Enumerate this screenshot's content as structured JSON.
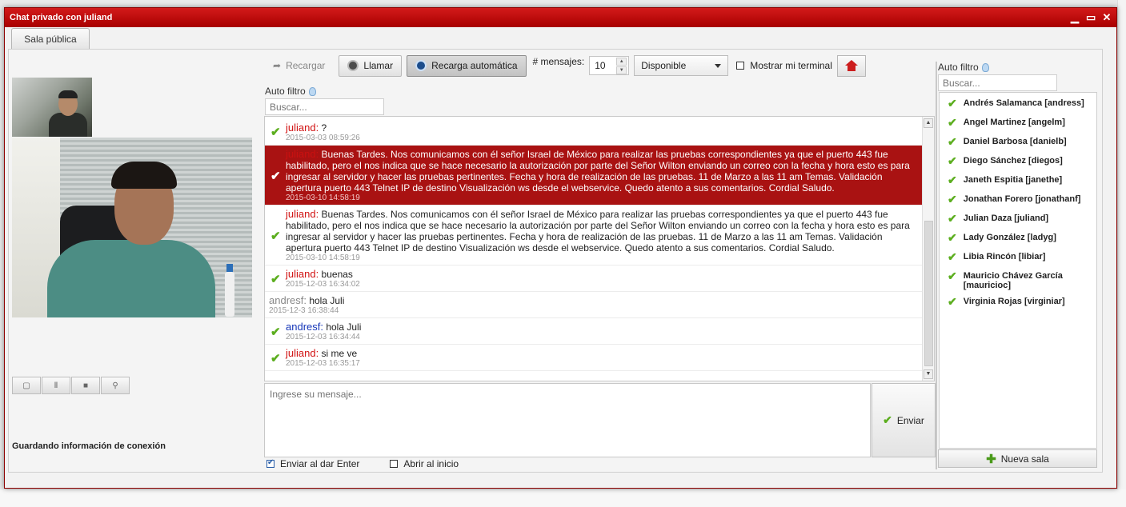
{
  "window": {
    "title": "Chat privado con juliand",
    "minimize_glyph": "▁",
    "maximize_glyph": "▭",
    "close_glyph": "✕"
  },
  "tabs": [
    {
      "label": "Sala pública",
      "active": true
    }
  ],
  "toolbar": {
    "reload_label": "Recargar",
    "call_label": "Llamar",
    "auto_reload_label": "Recarga automática",
    "messages_count_label": "# mensajes:",
    "messages_count_value": "10",
    "status_value": "Disponible",
    "show_terminal_label": "Mostrar mi terminal"
  },
  "chat_filter": {
    "label": "Auto filtro",
    "placeholder": "Buscar..."
  },
  "messages": [
    {
      "user": "juliand",
      "user_color": "red",
      "text": " ?",
      "time": "2015-03-03 08:59:26",
      "checked": true,
      "selected": false
    },
    {
      "user": "juliand",
      "user_color": "red",
      "text": " Buenas Tardes. Nos comunicamos con él señor Israel de México para realizar las pruebas correspondientes ya que el puerto 443 fue habilitado, pero el nos indica que se hace necesario la autorización por parte del Señor Wilton enviando un correo con la fecha y hora esto es para ingresar al servidor y hacer las pruebas pertinentes. Fecha y hora de realización de las pruebas. 11 de Marzo a las 11 am Temas. Validación apertura puerto 443 Telnet IP de destino Visualización ws desde el webservice. Quedo atento a sus comentarios. Cordial Saludo.",
      "time": "2015-03-10 14:58:19",
      "checked": true,
      "selected": true
    },
    {
      "user": "juliand",
      "user_color": "red",
      "text": " Buenas Tardes. Nos comunicamos con él señor Israel de México para realizar las pruebas correspondientes ya que el puerto 443 fue habilitado, pero el nos indica que se hace necesario la autorización por parte del Señor Wilton enviando un correo con la fecha y hora esto es para ingresar al servidor y hacer las pruebas pertinentes. Fecha y hora de realización de las pruebas. 11 de Marzo a las 11 am Temas. Validación apertura puerto 443 Telnet IP de destino Visualización ws desde el webservice. Quedo atento a sus comentarios. Cordial Saludo.",
      "time": "2015-03-10 14:58:19",
      "checked": true,
      "selected": false
    },
    {
      "user": "juliand",
      "user_color": "red",
      "text": " buenas",
      "time": "2015-12-03 16:34:02",
      "checked": true,
      "selected": false
    },
    {
      "user": "andresf",
      "user_color": "gray",
      "text": " hola Juli",
      "time": "2015-12-3 16:38:44",
      "checked": false,
      "selected": false
    },
    {
      "user": "andresf",
      "user_color": "blue",
      "text": " hola Juli",
      "time": "2015-12-03 16:34:44",
      "checked": true,
      "selected": false
    },
    {
      "user": "juliand",
      "user_color": "red",
      "text": " si me ve",
      "time": "2015-12-03 16:35:17",
      "checked": true,
      "selected": false
    }
  ],
  "compose": {
    "placeholder": "Ingrese su mensaje...",
    "send_label": "Enviar"
  },
  "options": {
    "send_on_enter_label": "Enviar al dar Enter",
    "send_on_enter": true,
    "open_at_start_label": "Abrir al inicio",
    "open_at_start": false
  },
  "status_text": "Guardando información de conexión",
  "users_filter": {
    "label": "Auto filtro",
    "placeholder": "Buscar..."
  },
  "users": [
    "Andrés Salamanca [andress]",
    "Angel Martinez [angelm]",
    "Daniel Barbosa [danielb]",
    "Diego Sánchez [diegos]",
    "Janeth Espitia [janethe]",
    "Jonathan Forero [jonathanf]",
    "Julian Daza [juliand]",
    "Lady González [ladyg]",
    "Libia Rincón [libiar]",
    "Mauricio Chávez García [mauricioc]",
    "Virginia Rojas [virginiar]"
  ],
  "new_room_label": "Nueva sala",
  "colors": {
    "titlebar": "#b80000",
    "selected_row": "#a91212",
    "user_red": "#d11212",
    "user_blue": "#1636b8",
    "check_green": "#5cae1f"
  }
}
